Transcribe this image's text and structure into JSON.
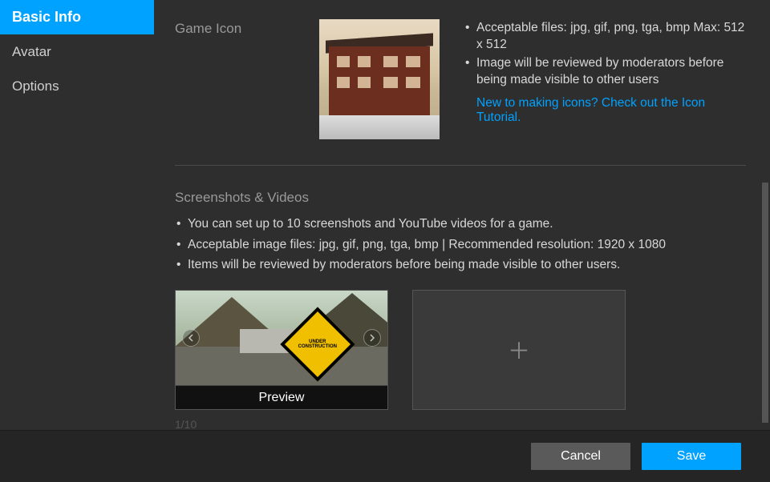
{
  "sidebar": {
    "items": [
      {
        "label": "Basic Info"
      },
      {
        "label": "Avatar"
      },
      {
        "label": "Options"
      }
    ]
  },
  "gameIcon": {
    "label": "Game Icon",
    "bullets": [
      "Acceptable files: jpg, gif, png, tga, bmp Max: 512 x 512",
      "Image will be reviewed by moderators before being made visible to other users"
    ],
    "link": "New to making icons? Check out the Icon Tutorial."
  },
  "screenshots": {
    "title": "Screenshots & Videos",
    "bullets": [
      "You can set up to 10 screenshots and YouTube videos for a game.",
      "Acceptable image files: jpg, gif, png, tga, bmp | Recommended resolution: 1920 x 1080",
      "Items will be reviewed by moderators before being made visible to other users."
    ],
    "previewLabel": "Preview",
    "signText": "UNDER CONSTRUCTION",
    "counter": "1/10"
  },
  "footer": {
    "cancel": "Cancel",
    "save": "Save"
  }
}
